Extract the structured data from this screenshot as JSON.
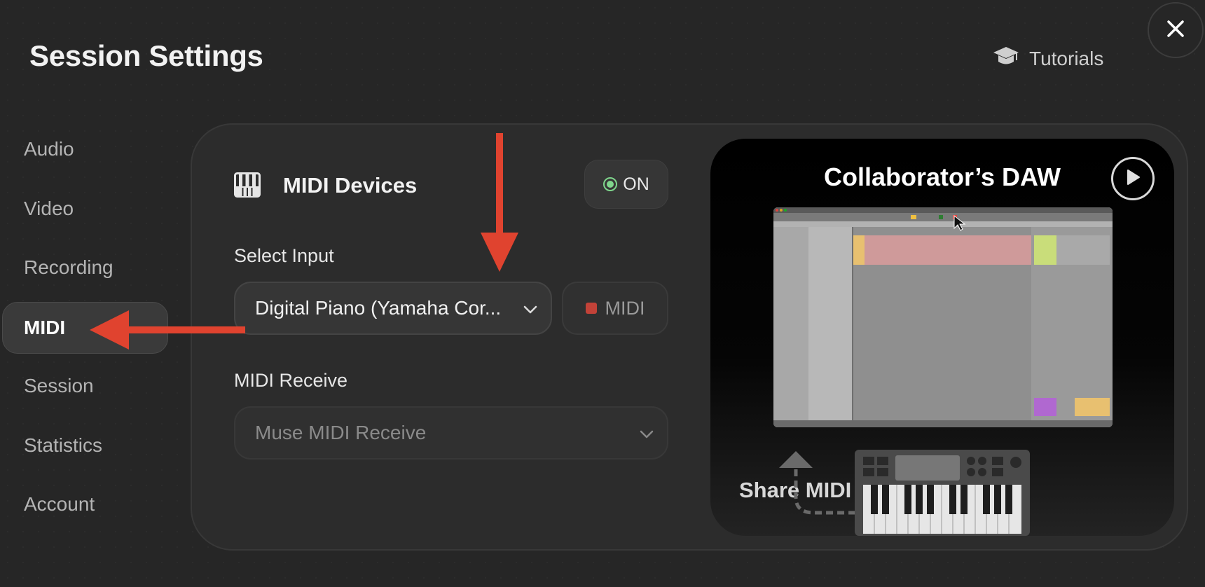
{
  "header": {
    "title": "Session Settings",
    "tutorials_label": "Tutorials"
  },
  "sidebar": {
    "items": [
      {
        "label": "Audio"
      },
      {
        "label": "Video"
      },
      {
        "label": "Recording"
      },
      {
        "label": "MIDI",
        "active": true
      },
      {
        "label": "Session"
      },
      {
        "label": "Statistics"
      },
      {
        "label": "Account"
      }
    ]
  },
  "midi_devices": {
    "title": "MIDI Devices",
    "toggle_label": "ON",
    "toggle_state": "on",
    "select_input_label": "Select Input",
    "selected_input": "Digital Piano (Yamaha Cor...",
    "midi_button_label": "MIDI",
    "midi_receive_label": "MIDI Receive",
    "midi_receive_value": "Muse MIDI Receive"
  },
  "promo": {
    "title": "Collaborator’s DAW",
    "share_label": "Share MIDI"
  },
  "colors": {
    "background": "#262626",
    "panel": "#2c2c2c",
    "accent_red": "#e0432f",
    "toggle_green": "#7fd58c",
    "record_red": "#c24238"
  },
  "icons": [
    "close-icon",
    "graduation-cap-icon",
    "piano-keys-icon",
    "chevron-down-icon",
    "record-square-icon",
    "play-icon",
    "keyboard-controller-icon"
  ]
}
